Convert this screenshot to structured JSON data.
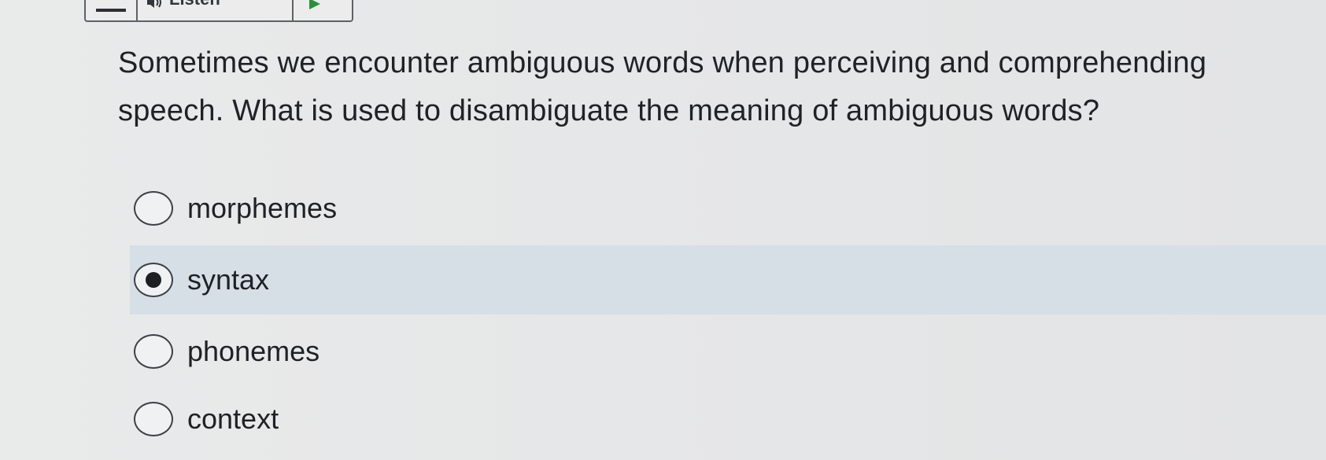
{
  "toolbar": {
    "listen_label": "Listen",
    "icons": [
      "menu-icon",
      "speaker-icon",
      "play-icon"
    ],
    "play_color": "#2e8f3a"
  },
  "question": {
    "text": "Sometimes we encounter ambiguous words when perceiving and comprehending speech. What is used to disambiguate the meaning of ambiguous words?"
  },
  "options": [
    {
      "label": "morphemes",
      "selected": false
    },
    {
      "label": "syntax",
      "selected": true
    },
    {
      "label": "phonemes",
      "selected": false
    },
    {
      "label": "context",
      "selected": false
    }
  ],
  "colors": {
    "selected_row": "#d7dfe6",
    "background": "#e7e8e9"
  }
}
